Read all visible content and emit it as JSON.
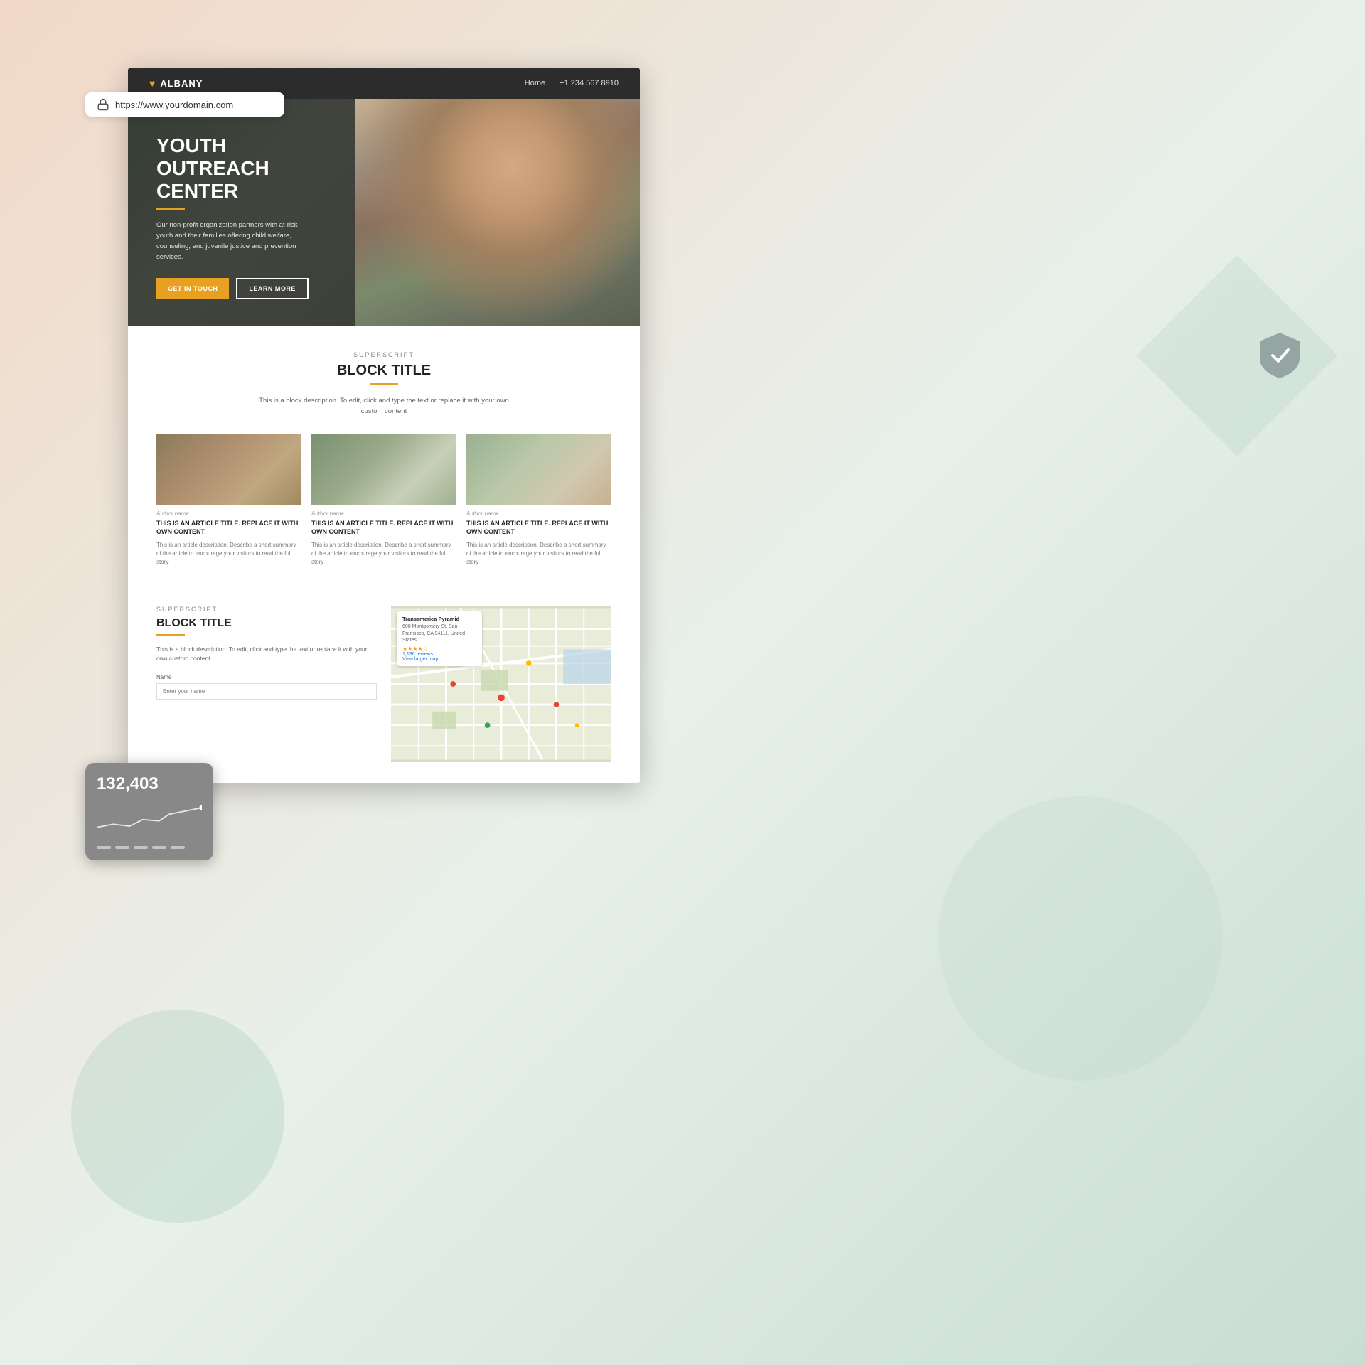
{
  "browser": {
    "url": "https://www.yourdomain.com",
    "lock_icon": "lock"
  },
  "site": {
    "logo": "ALBANY",
    "nav": {
      "home": "Home",
      "phone": "+1 234 567 8910"
    },
    "hero": {
      "title": "YOUTH OUTREACH CENTER",
      "description": "Our non-profit organization partners with at-risk youth and their families offering child welfare, counseling, and juvenile justice and prevention services.",
      "cta_primary": "GET IN TOUCH",
      "cta_secondary": "LEARN MORE"
    },
    "block1": {
      "superscript": "SUPERSCRIPT",
      "title": "BLOCK TITLE",
      "description": "This is a block description. To edit, click and type the text or replace it with your own custom content",
      "articles": [
        {
          "author": "Author name",
          "title": "THIS IS AN ARTICLE TITLE. REPLACE IT WITH OWN CONTENT",
          "description": "This is an article description. Describe a short summary of the article to encourage your visitors to read the full story"
        },
        {
          "author": "Author name",
          "title": "THIS IS AN ARTICLE TITLE. REPLACE IT WITH OWN CONTENT",
          "description": "This is an article description. Describe a short summary of the article to encourage your visitors to read the full story"
        },
        {
          "author": "Author name",
          "title": "THIS IS AN ARTICLE TITLE. REPLACE IT WITH OWN CONTENT",
          "description": "This is an article description. Describe a short summary of the article to encourage your visitors to read the full story"
        }
      ]
    },
    "block2": {
      "superscript": "SUPERSCRIPT",
      "title": "BLOCK TITLE",
      "description": "This is a block description. To edit, click and type the text or replace it with your own custom content",
      "form": {
        "name_label": "Name",
        "name_placeholder": "Enter your name"
      }
    },
    "map": {
      "business_name": "Transamerica Pyramid",
      "address": "600 Montgomery St, San Francisco, CA 94111, United States",
      "rating": "4.6",
      "reviews": "1,136 reviews",
      "view_larger": "View larger map"
    }
  },
  "analytics": {
    "number": "132,403"
  },
  "shield": {
    "verified": true
  }
}
